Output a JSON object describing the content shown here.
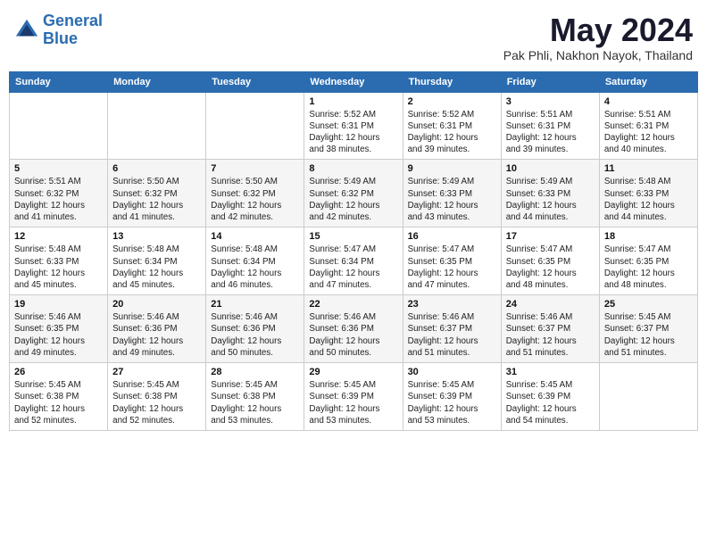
{
  "header": {
    "logo_line1": "General",
    "logo_line2": "Blue",
    "title": "May 2024",
    "location": "Pak Phli, Nakhon Nayok, Thailand"
  },
  "weekdays": [
    "Sunday",
    "Monday",
    "Tuesday",
    "Wednesday",
    "Thursday",
    "Friday",
    "Saturday"
  ],
  "weeks": [
    [
      {
        "day": "",
        "info": ""
      },
      {
        "day": "",
        "info": ""
      },
      {
        "day": "",
        "info": ""
      },
      {
        "day": "1",
        "info": "Sunrise: 5:52 AM\nSunset: 6:31 PM\nDaylight: 12 hours\nand 38 minutes."
      },
      {
        "day": "2",
        "info": "Sunrise: 5:52 AM\nSunset: 6:31 PM\nDaylight: 12 hours\nand 39 minutes."
      },
      {
        "day": "3",
        "info": "Sunrise: 5:51 AM\nSunset: 6:31 PM\nDaylight: 12 hours\nand 39 minutes."
      },
      {
        "day": "4",
        "info": "Sunrise: 5:51 AM\nSunset: 6:31 PM\nDaylight: 12 hours\nand 40 minutes."
      }
    ],
    [
      {
        "day": "5",
        "info": "Sunrise: 5:51 AM\nSunset: 6:32 PM\nDaylight: 12 hours\nand 41 minutes."
      },
      {
        "day": "6",
        "info": "Sunrise: 5:50 AM\nSunset: 6:32 PM\nDaylight: 12 hours\nand 41 minutes."
      },
      {
        "day": "7",
        "info": "Sunrise: 5:50 AM\nSunset: 6:32 PM\nDaylight: 12 hours\nand 42 minutes."
      },
      {
        "day": "8",
        "info": "Sunrise: 5:49 AM\nSunset: 6:32 PM\nDaylight: 12 hours\nand 42 minutes."
      },
      {
        "day": "9",
        "info": "Sunrise: 5:49 AM\nSunset: 6:33 PM\nDaylight: 12 hours\nand 43 minutes."
      },
      {
        "day": "10",
        "info": "Sunrise: 5:49 AM\nSunset: 6:33 PM\nDaylight: 12 hours\nand 44 minutes."
      },
      {
        "day": "11",
        "info": "Sunrise: 5:48 AM\nSunset: 6:33 PM\nDaylight: 12 hours\nand 44 minutes."
      }
    ],
    [
      {
        "day": "12",
        "info": "Sunrise: 5:48 AM\nSunset: 6:33 PM\nDaylight: 12 hours\nand 45 minutes."
      },
      {
        "day": "13",
        "info": "Sunrise: 5:48 AM\nSunset: 6:34 PM\nDaylight: 12 hours\nand 45 minutes."
      },
      {
        "day": "14",
        "info": "Sunrise: 5:48 AM\nSunset: 6:34 PM\nDaylight: 12 hours\nand 46 minutes."
      },
      {
        "day": "15",
        "info": "Sunrise: 5:47 AM\nSunset: 6:34 PM\nDaylight: 12 hours\nand 47 minutes."
      },
      {
        "day": "16",
        "info": "Sunrise: 5:47 AM\nSunset: 6:35 PM\nDaylight: 12 hours\nand 47 minutes."
      },
      {
        "day": "17",
        "info": "Sunrise: 5:47 AM\nSunset: 6:35 PM\nDaylight: 12 hours\nand 48 minutes."
      },
      {
        "day": "18",
        "info": "Sunrise: 5:47 AM\nSunset: 6:35 PM\nDaylight: 12 hours\nand 48 minutes."
      }
    ],
    [
      {
        "day": "19",
        "info": "Sunrise: 5:46 AM\nSunset: 6:35 PM\nDaylight: 12 hours\nand 49 minutes."
      },
      {
        "day": "20",
        "info": "Sunrise: 5:46 AM\nSunset: 6:36 PM\nDaylight: 12 hours\nand 49 minutes."
      },
      {
        "day": "21",
        "info": "Sunrise: 5:46 AM\nSunset: 6:36 PM\nDaylight: 12 hours\nand 50 minutes."
      },
      {
        "day": "22",
        "info": "Sunrise: 5:46 AM\nSunset: 6:36 PM\nDaylight: 12 hours\nand 50 minutes."
      },
      {
        "day": "23",
        "info": "Sunrise: 5:46 AM\nSunset: 6:37 PM\nDaylight: 12 hours\nand 51 minutes."
      },
      {
        "day": "24",
        "info": "Sunrise: 5:46 AM\nSunset: 6:37 PM\nDaylight: 12 hours\nand 51 minutes."
      },
      {
        "day": "25",
        "info": "Sunrise: 5:45 AM\nSunset: 6:37 PM\nDaylight: 12 hours\nand 51 minutes."
      }
    ],
    [
      {
        "day": "26",
        "info": "Sunrise: 5:45 AM\nSunset: 6:38 PM\nDaylight: 12 hours\nand 52 minutes."
      },
      {
        "day": "27",
        "info": "Sunrise: 5:45 AM\nSunset: 6:38 PM\nDaylight: 12 hours\nand 52 minutes."
      },
      {
        "day": "28",
        "info": "Sunrise: 5:45 AM\nSunset: 6:38 PM\nDaylight: 12 hours\nand 53 minutes."
      },
      {
        "day": "29",
        "info": "Sunrise: 5:45 AM\nSunset: 6:39 PM\nDaylight: 12 hours\nand 53 minutes."
      },
      {
        "day": "30",
        "info": "Sunrise: 5:45 AM\nSunset: 6:39 PM\nDaylight: 12 hours\nand 53 minutes."
      },
      {
        "day": "31",
        "info": "Sunrise: 5:45 AM\nSunset: 6:39 PM\nDaylight: 12 hours\nand 54 minutes."
      },
      {
        "day": "",
        "info": ""
      }
    ]
  ]
}
